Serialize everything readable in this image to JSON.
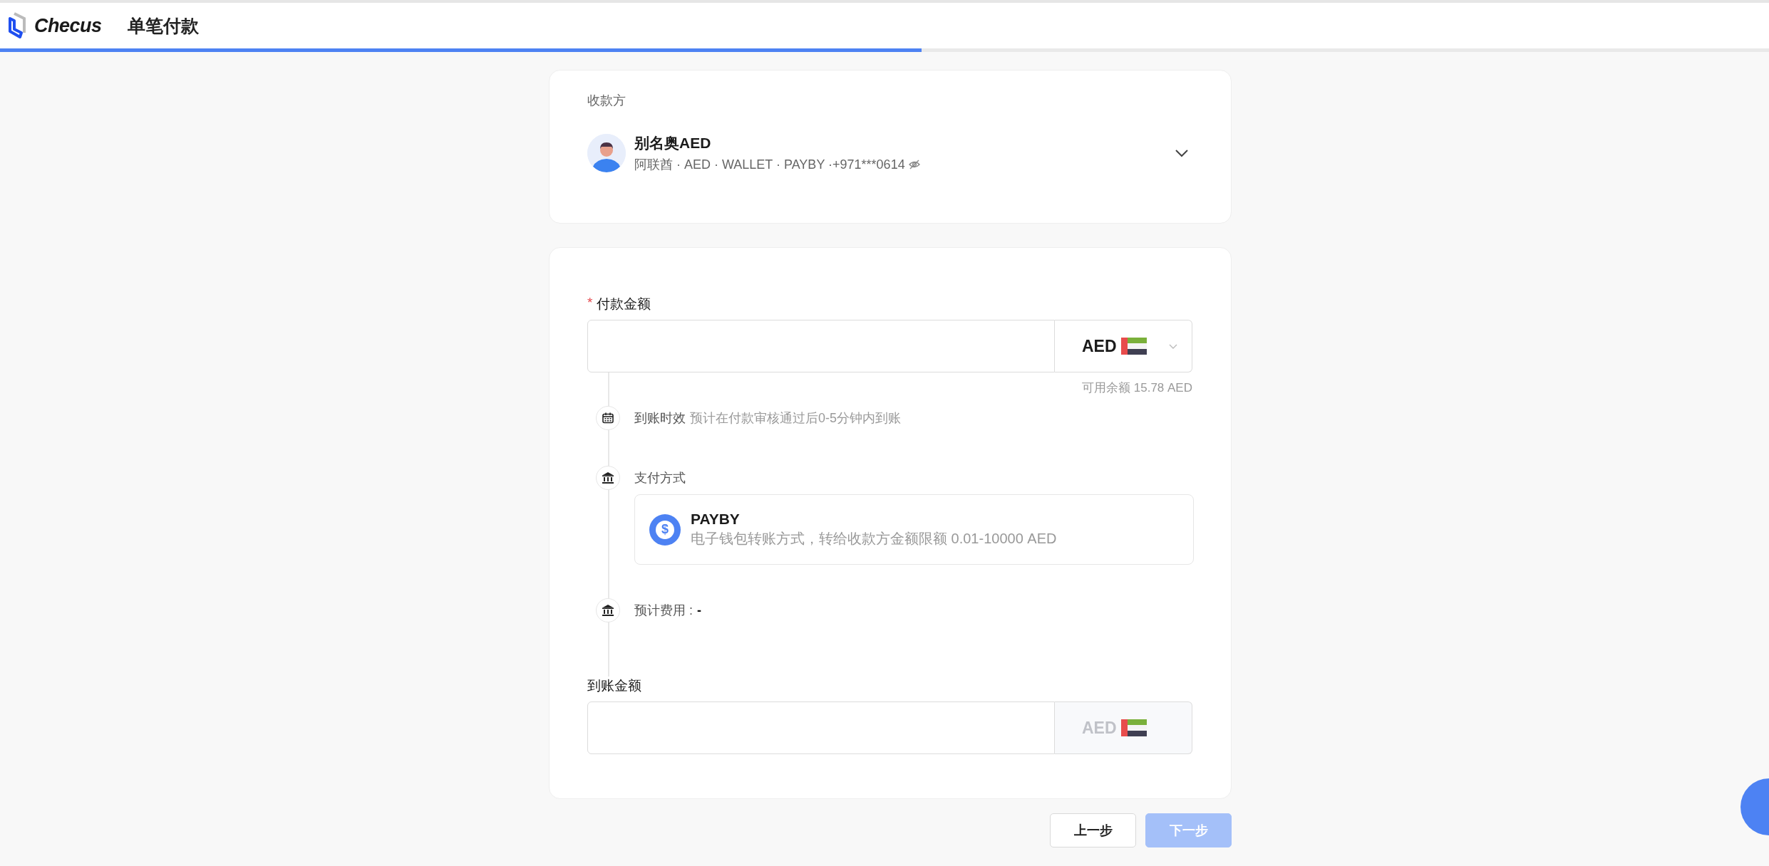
{
  "header": {
    "brand": "Checus",
    "title": "单笔付款",
    "progress": {
      "level": 0.521
    }
  },
  "payee": {
    "label": "收款方",
    "name": "别名奥AED",
    "details": "阿联酋 · AED · WALLET · PAYBY ·+971***0614"
  },
  "amount": {
    "label": "付款金额",
    "required_mark": "*",
    "currency": "AED",
    "disabled": false,
    "balance": "可用余额 15.78 AED"
  },
  "steps": [
    {
      "kind": "calendar",
      "label": "到账时效",
      "value": "预计在付款审核通过后0-5分钟内到账"
    },
    {
      "kind": "bank",
      "label": "支付方式",
      "method": {
        "icon_glyph": "$",
        "name": "PAYBY",
        "description": "电子钱包转账方式，转给收款方金额限额 0.01-10000 AED"
      }
    },
    {
      "kind": "fee",
      "label": "预计费用 :",
      "value": "-"
    }
  ],
  "received": {
    "label": "到账金额",
    "currency": "AED",
    "disabled": true
  },
  "buttons": [
    {
      "label": "上一步",
      "kind": "secondary",
      "disabled": false
    },
    {
      "label": "下一步",
      "kind": "primary",
      "disabled": true
    }
  ]
}
